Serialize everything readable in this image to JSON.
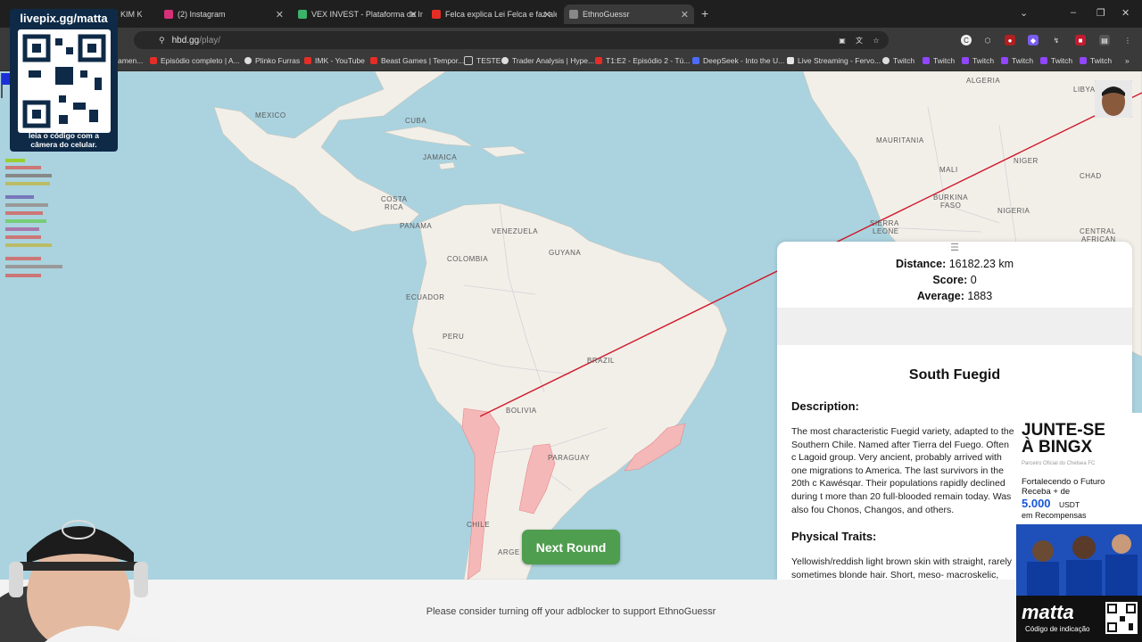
{
  "browser": {
    "tabs": [
      {
        "label": "DE KIM K",
        "active": false
      },
      {
        "label": "(2) Instagram",
        "active": false
      },
      {
        "label": "VEX INVEST - Plataforma de Inv",
        "active": false
      },
      {
        "label": "Felca explica Lei Felca e faz aler",
        "active": false
      },
      {
        "label": "EthnoGuessr",
        "active": true
      }
    ],
    "url_host": "hbd.gg",
    "url_path": "/play/",
    "bookmarks": [
      {
        "label": "amen..."
      },
      {
        "label": "Episódio completo | A..."
      },
      {
        "label": "Plinko Furras"
      },
      {
        "label": "IMK - YouTube"
      },
      {
        "label": "Beast Games | Tempor..."
      },
      {
        "label": "TESTE"
      },
      {
        "label": "Trader Analysis | Hype..."
      },
      {
        "label": "T1:E2 - Episódio 2 - Tú..."
      },
      {
        "label": "DeepSeek - Into the U..."
      },
      {
        "label": "Live Streaming - Fervo..."
      },
      {
        "label": "Twitch"
      },
      {
        "label": "Twitch"
      },
      {
        "label": "Twitch"
      },
      {
        "label": "Twitch"
      },
      {
        "label": "Twitch"
      },
      {
        "label": "Twitch"
      }
    ]
  },
  "map": {
    "labels": [
      "MEXICO",
      "CUBA",
      "JAMAICA",
      "PANAMA",
      "VENEZUELA",
      "COLOMBIA",
      "GUYANA",
      "ECUADOR",
      "PERU",
      "BRAZIL",
      "BOLIVIA",
      "PARAGUAY",
      "CHILE",
      "ARGE",
      "ALGERIA",
      "LIBYA",
      "MAURITANIA",
      "MALI",
      "NIGER",
      "CHAD",
      "BURKINA",
      "FASO",
      "SIERRA",
      "LEONE",
      "NIGERIA",
      "CENTRAL",
      "AFRICAN",
      "COSTA",
      "RICA"
    ]
  },
  "result": {
    "drag_handle": "☰",
    "distance_label": "Distance:",
    "distance_value": "16182.23 km",
    "score_label": "Score:",
    "score_value": "0",
    "average_label": "Average:",
    "average_value": "1883",
    "title": "South Fuegid",
    "description_heading": "Description:",
    "description_text": "The most characteristic Fuegid variety, adapted to the Southern Chile. Named after Tierra del Fuego. Often c Lagoid group. Very ancient, probably arrived with one migrations to America. The last survivors in the 20th c Kawésqar. Their populations rapidly declined during t more than 20 full-blooded remain today. Was also fou Chonos, Changos, and others.",
    "traits_heading": "Physical Traits:",
    "traits_text": "Yellowish/reddish light brown skin with straight, rarely sometimes blonde hair. Short, meso- macroskelic, enc"
  },
  "next_round_label": "Next Round",
  "footer_text": "Please consider turning off your adblocker to support EthnoGuessr",
  "overlay": {
    "qr_title": "livepix.gg/matta",
    "qr_caption_1": "leia o código com a",
    "qr_caption_2": "câmera do celular.",
    "ad_heading_1": "JUNTE-SE",
    "ad_heading_2": "À BINGX",
    "ad_sub": "Parceiro Oficial do Chelsea FC",
    "ad_line_1": "Fortalecendo o Futuro",
    "ad_line_2": "Receba + de",
    "ad_amount": "5.000",
    "ad_currency": "USDT",
    "ad_line_3": "em Recompensas",
    "ad_brand": "matta",
    "ad_code": "Código de indicação"
  },
  "colors": {
    "ocean": "#aad3df",
    "land": "#f2efe9",
    "region": "#f5b8b8",
    "guess_line": "#d0192a",
    "flag": "#1a2fd6",
    "button": "#4f9d4f"
  }
}
